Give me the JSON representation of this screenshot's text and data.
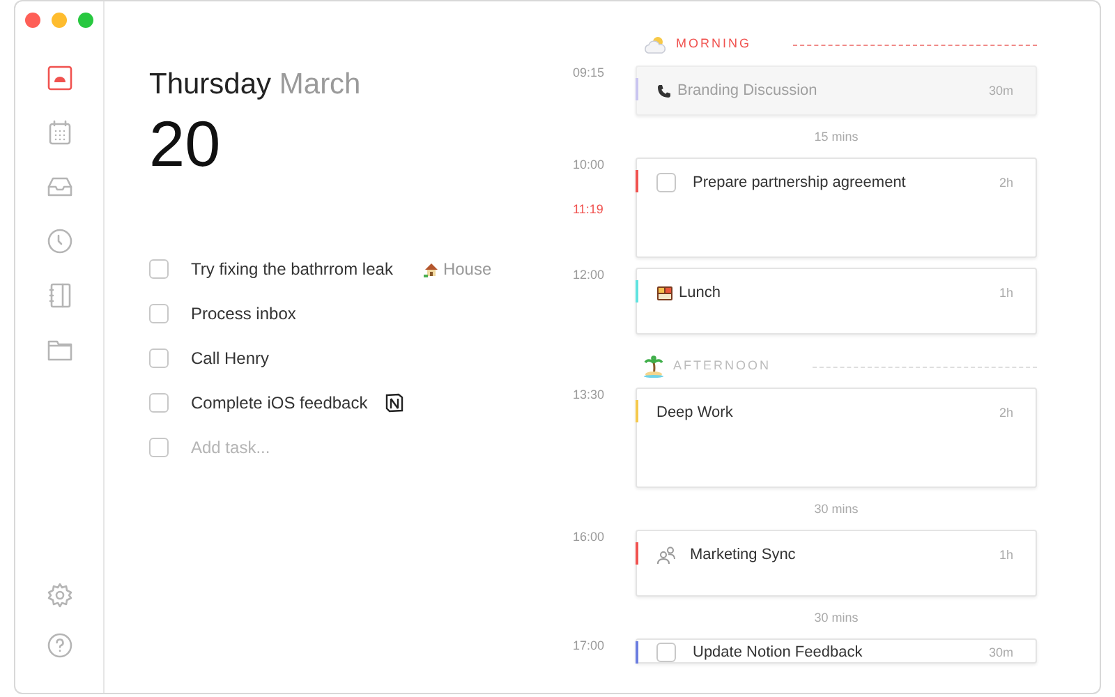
{
  "sidebar": {
    "items": [
      {
        "selected": true
      },
      {
        "selected": false
      },
      {
        "selected": false
      },
      {
        "selected": false
      },
      {
        "selected": false
      },
      {
        "selected": false
      }
    ]
  },
  "date": {
    "weekday": "Thursday",
    "month": "March",
    "day": "20"
  },
  "tasks": [
    {
      "label": "Try fixing the bathrrom leak",
      "checked": false,
      "tag": {
        "kind": "house",
        "label": "House"
      }
    },
    {
      "label": "Process inbox",
      "checked": false
    },
    {
      "label": "Call Henry",
      "checked": false
    },
    {
      "label": "Complete iOS feedback",
      "checked": false,
      "tag": {
        "kind": "notion"
      }
    }
  ],
  "add_task": {
    "placeholder": "Add task...",
    "checked": false
  },
  "timeline": [
    {
      "kind": "section",
      "label": "MORNING"
    },
    {
      "kind": "call",
      "time": "09:15",
      "title": "Branding Discussion",
      "duration": "30m",
      "color": "#c9c5f0",
      "past": true
    },
    {
      "kind": "gap",
      "label": "15 mins"
    },
    {
      "kind": "task",
      "time": "10:00",
      "now": "11:19",
      "checked": false,
      "title": "Prepare partnership agreement",
      "duration": "2h",
      "color": "#f0524f",
      "past": false
    },
    {
      "kind": "lunch",
      "time": "12:00",
      "title": "Lunch",
      "duration": "1h",
      "color": "#5fe3e0",
      "past": false
    },
    {
      "kind": "section",
      "label": "AFTERNOON"
    },
    {
      "kind": "plain",
      "time": "13:30",
      "title": "Deep Work",
      "duration": "2h",
      "color": "#f5c94c",
      "past": false
    },
    {
      "kind": "gap",
      "label": "30 mins"
    },
    {
      "kind": "meeting",
      "time": "16:00",
      "title": "Marketing Sync",
      "duration": "1h",
      "color": "#f0524f",
      "past": false
    },
    {
      "kind": "gap",
      "label": "30 mins"
    },
    {
      "kind": "task",
      "time": "17:00",
      "checked": false,
      "title": "Update Notion Feedback",
      "duration": "30m",
      "color": "#6b7de0",
      "past": false
    }
  ]
}
